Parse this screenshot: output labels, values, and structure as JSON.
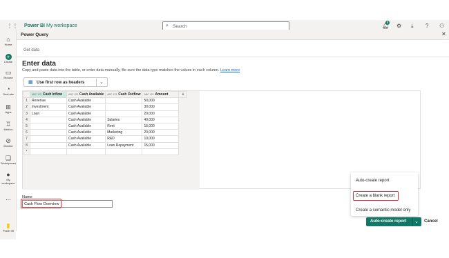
{
  "topbar": {
    "brand": "Power BI",
    "workspace": "My workspace",
    "search_placeholder": "Search",
    "notification_count": "8"
  },
  "rail": {
    "items": [
      {
        "label": "Home"
      },
      {
        "label": "Create"
      },
      {
        "label": "Browse"
      },
      {
        "label": "OneLake"
      },
      {
        "label": "Apps"
      },
      {
        "label": "Metrics"
      },
      {
        "label": "Monitor"
      },
      {
        "label": "Workspaces"
      },
      {
        "label": "My workspace"
      },
      {
        "label": "..."
      }
    ],
    "footer_label": "Power BI"
  },
  "dialog": {
    "title": "Power Query",
    "step": "Get data",
    "heading": "Enter data",
    "description": "Copy and paste data into the table, or enter data manually. Be sure the data type matches the values in each column.",
    "learn_more": "Learn more",
    "use_headers_label": "Use first row as headers"
  },
  "table": {
    "columns": [
      {
        "type": "ABC 123",
        "name": "Cash Inflow"
      },
      {
        "type": "ABC 123",
        "name": "Cash Available"
      },
      {
        "type": "ABC 123",
        "name": "Cash Outflow"
      },
      {
        "type": "ABC 123",
        "name": "Amount"
      }
    ],
    "add_column": "+",
    "rows": [
      {
        "n": "1",
        "cells": [
          "Revenue",
          "Cash Available",
          "",
          "50,000"
        ]
      },
      {
        "n": "2",
        "cells": [
          "Investment",
          "Cash Available",
          "",
          "30,000"
        ]
      },
      {
        "n": "3",
        "cells": [
          "Loan",
          "Cash Available",
          "",
          "20,000"
        ]
      },
      {
        "n": "4",
        "cells": [
          "",
          "Cash Available",
          "Salaries",
          "40,000"
        ]
      },
      {
        "n": "5",
        "cells": [
          "",
          "Cash Available",
          "Rent",
          "15,000"
        ]
      },
      {
        "n": "6",
        "cells": [
          "",
          "Cash Available",
          "Marketing",
          "20,000"
        ]
      },
      {
        "n": "7",
        "cells": [
          "",
          "Cash Available",
          "R&D",
          "10,000"
        ]
      },
      {
        "n": "8",
        "cells": [
          "",
          "Cash Available",
          "Loan Repayment",
          "15,000"
        ]
      }
    ],
    "add_row": "*"
  },
  "name_field": {
    "label": "Name",
    "value": "Cash Flow Overview"
  },
  "menu": {
    "items": [
      "Auto-create report",
      "Create a blank report",
      "Create a semantic model only"
    ]
  },
  "actions": {
    "primary": "Auto-create report",
    "cancel": "Cancel"
  },
  "colors": {
    "accent": "#117865",
    "highlight": "#d13438",
    "link": "#0f6cbd"
  }
}
